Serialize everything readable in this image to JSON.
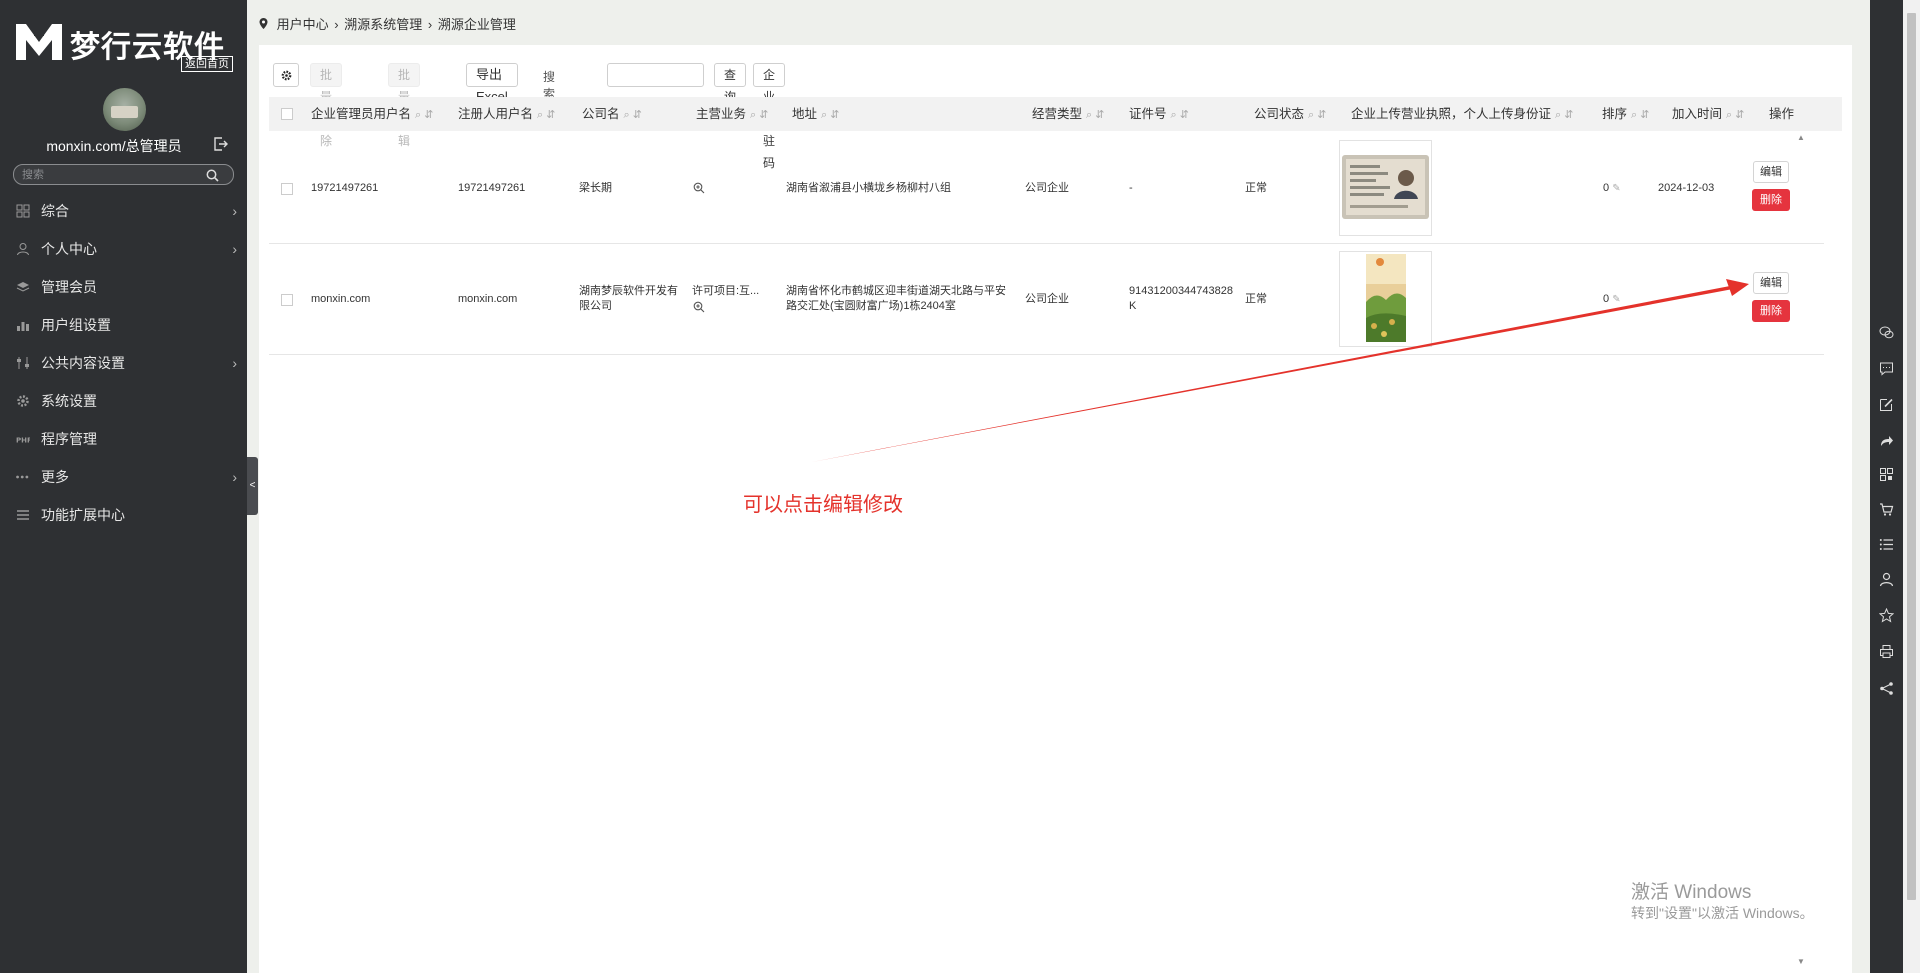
{
  "sidebar": {
    "brand": "梦行云软件",
    "home_link": "返回首页",
    "username": "monxin.com/总管理员",
    "search_placeholder": "搜索",
    "menu": [
      {
        "label": "综合",
        "icon": "grid-icon",
        "has_children": true
      },
      {
        "label": "个人中心",
        "icon": "user-icon",
        "has_children": true
      },
      {
        "label": "管理会员",
        "icon": "layers-icon",
        "has_children": false
      },
      {
        "label": "用户组设置",
        "icon": "bar-chart-icon",
        "has_children": false
      },
      {
        "label": "公共内容设置",
        "icon": "sliders-icon",
        "has_children": true
      },
      {
        "label": "系统设置",
        "icon": "gear-icon",
        "has_children": false
      },
      {
        "label": "程序管理",
        "icon": "php-icon",
        "has_children": false
      },
      {
        "label": "更多",
        "icon": "more-dots-icon",
        "has_children": true
      },
      {
        "label": "功能扩展中心",
        "icon": "list-icon",
        "has_children": false
      }
    ],
    "collapse_glyph": "<"
  },
  "breadcrumb": [
    "用户中心",
    "溯源系统管理",
    "溯源企业管理"
  ],
  "breadcrumb_sep": "›",
  "toolbar": {
    "batch_delete": "批量删除",
    "batch_edit": "批量编辑",
    "export_excel": "导出 Excel",
    "search_label": "搜索",
    "search_value": "",
    "query": "查询",
    "enterprise_code": "企业入驻码"
  },
  "table": {
    "columns": [
      "企业管理员用户名",
      "注册人用户名",
      "公司名",
      "主营业务",
      "地址",
      "经营类型",
      "证件号",
      "公司状态",
      "企业上传营业执照，个人上传身份证",
      "排序",
      "加入时间",
      "操作"
    ],
    "rows": [
      {
        "admin_user": "19721497261",
        "register_user": "19721497261",
        "company": "梁长期",
        "business": "",
        "address": "湖南省溆浦县小横垅乡杨柳村八组",
        "biz_type": "公司企业",
        "cert_no": "-",
        "status": "正常",
        "license_image": "id-card-photo",
        "sort": "0",
        "join_time": "2024-12-03",
        "edit": "编辑",
        "delete": "删除"
      },
      {
        "admin_user": "monxin.com",
        "register_user": "monxin.com",
        "company": "湖南梦辰软件开发有限公司",
        "business": "许可项目:互...",
        "address": "湖南省怀化市鹤城区迎丰街道湖天北路与平安路交汇处(宝圆财富广场)1栋2404室",
        "biz_type": "公司企业",
        "cert_no": "91431200344743828K",
        "status": "正常",
        "license_image": "garden-photo",
        "sort": "0",
        "join_time": "",
        "edit": "编辑",
        "delete": "删除"
      }
    ]
  },
  "annotation": {
    "note": "可以点击编辑修改",
    "arrow_color": "#e4322b"
  },
  "watermark": {
    "line1": "激活 Windows",
    "line2": "转到\"设置\"以激活 Windows。"
  },
  "right_rail_icons": [
    "chat-bubbles-icon",
    "comment-icon",
    "edit-icon",
    "share-arrow-icon",
    "qrcode-icon",
    "cart-icon",
    "list-icon",
    "person-icon",
    "star-icon",
    "printer-icon",
    "share-icon"
  ]
}
